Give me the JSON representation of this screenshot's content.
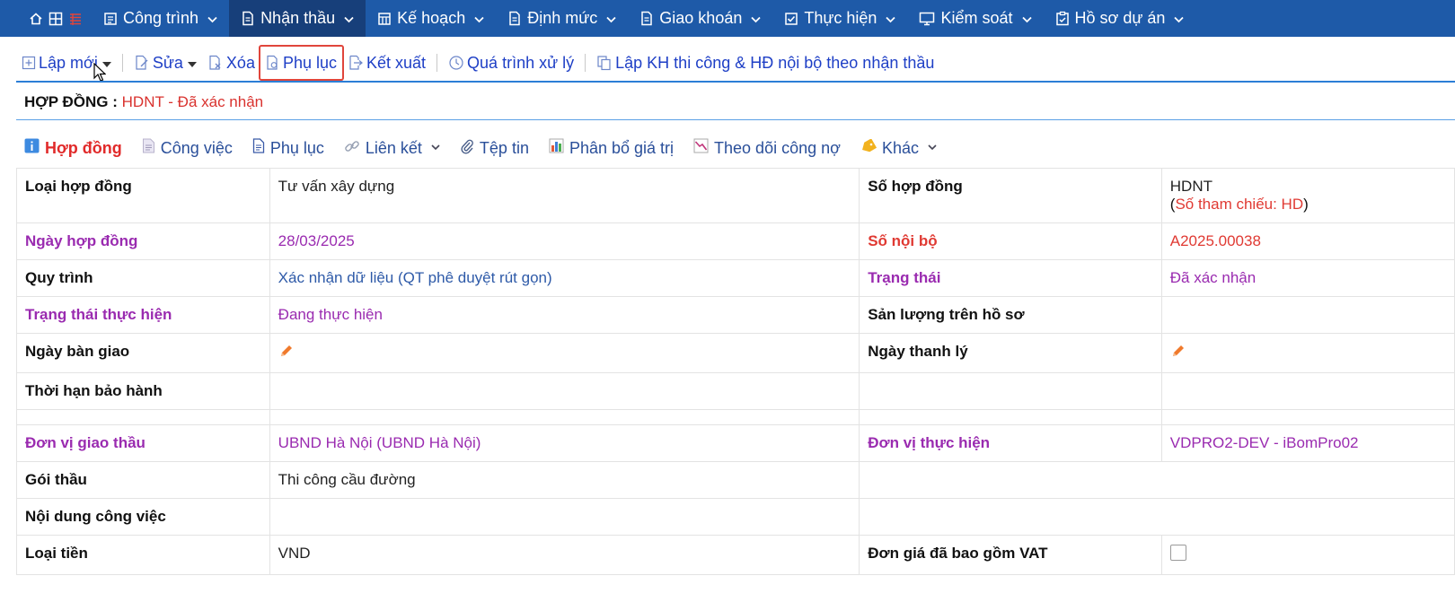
{
  "nav": {
    "items": [
      {
        "label": "Công trình",
        "icon": "building-doc-icon"
      },
      {
        "label": "Nhận thầu",
        "icon": "document-icon",
        "active": true
      },
      {
        "label": "Kế hoạch",
        "icon": "calendar-grid-icon"
      },
      {
        "label": "Định mức",
        "icon": "document-icon"
      },
      {
        "label": "Giao khoán",
        "icon": "document-icon"
      },
      {
        "label": "Thực hiện",
        "icon": "check-square-icon"
      },
      {
        "label": "Kiểm soát",
        "icon": "monitor-icon"
      },
      {
        "label": "Hồ sơ dự án",
        "icon": "clipboard-check-icon"
      }
    ]
  },
  "toolbar": {
    "new_label": "Lập mới",
    "edit_label": "Sửa",
    "delete_label": "Xóa",
    "appendix_label": "Phụ lục",
    "export_label": "Kết xuất",
    "process_label": "Quá trình xử lý",
    "plan_label": "Lập KH thi công & HĐ nội bộ theo nhận thầu"
  },
  "contract": {
    "heading": "HỢP ĐỒNG :",
    "value": "HDNT - Đã xác nhận"
  },
  "tabs": [
    {
      "label": "Hợp đồng",
      "icon": "info-icon",
      "active": true
    },
    {
      "label": "Công việc",
      "icon": "page-icon"
    },
    {
      "label": "Phụ lục",
      "icon": "document-icon"
    },
    {
      "label": "Liên kết",
      "icon": "link-icon",
      "dropdown": true
    },
    {
      "label": "Tệp tin",
      "icon": "paperclip-icon"
    },
    {
      "label": "Phân bổ giá trị",
      "icon": "bar-chart-icon"
    },
    {
      "label": "Theo dõi công nợ",
      "icon": "line-chart-icon"
    },
    {
      "label": "Khác",
      "icon": "tag-icon",
      "dropdown": true
    }
  ],
  "details": {
    "contract_type_label": "Loại hợp đồng",
    "contract_type": "Tư vấn xây dựng",
    "contract_no_label": "Số hợp đồng",
    "contract_no": "HDNT",
    "ref_open": "(",
    "ref_text": "Số tham chiếu: HD",
    "ref_close": ")",
    "contract_date_label": "Ngày hợp đồng",
    "contract_date": "28/03/2025",
    "internal_no_label": "Số nội bộ",
    "internal_no": "A2025.00038",
    "workflow_label": "Quy trình",
    "workflow": "Xác nhận dữ liệu (QT phê duyệt rút gọn)",
    "status_label": "Trạng thái",
    "status": "Đã xác nhận",
    "exec_status_label": "Trạng thái thực hiện",
    "exec_status": "Đang thực hiện",
    "output_label": "Sản lượng trên hồ sơ",
    "handover_label": "Ngày bàn giao",
    "liquidation_label": "Ngày thanh lý",
    "warranty_label": "Thời hạn bảo hành",
    "contractor_label": "Đơn vị giao thầu",
    "contractor": "UBND Hà Nội (UBND Hà Nội)",
    "executor_label": "Đơn vị thực hiện",
    "executor": "VDPRO2-DEV - iBomPro02",
    "package_label": "Gói thầu",
    "package": "Thi công cầu đường",
    "work_content_label": "Nội dung công việc",
    "currency_label": "Loại tiền",
    "currency": "VND",
    "vat_label": "Đơn giá đã bao gồm VAT",
    "vat_included": false
  },
  "colors": {
    "nav_bg": "#1e5aa8",
    "nav_active": "#173f7a",
    "link_blue": "#1e3fc6",
    "purple": "#9a2bb0",
    "red": "#e03a33",
    "highlight_box": "#e0453b"
  }
}
